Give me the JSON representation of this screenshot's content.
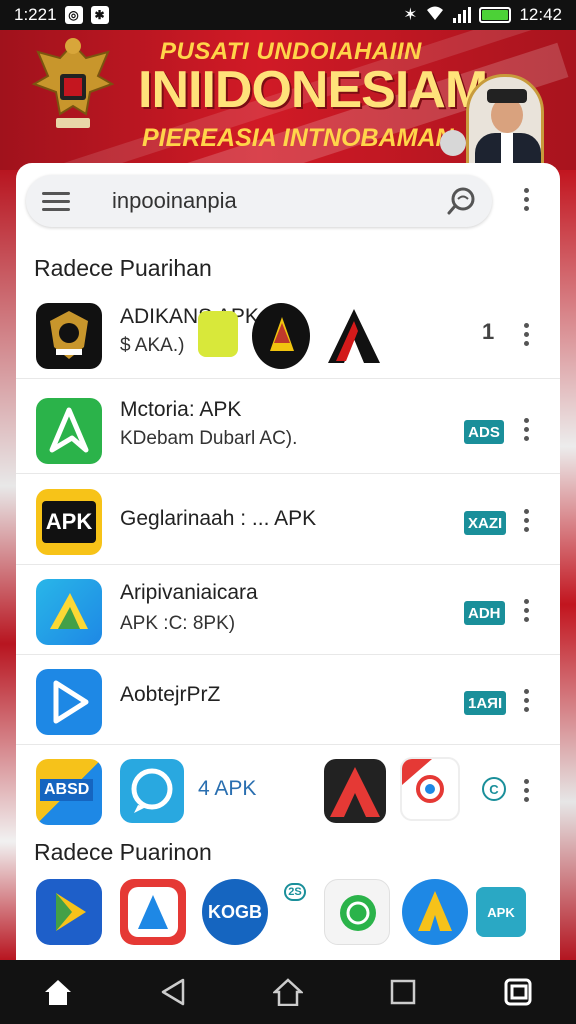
{
  "status_bar": {
    "time_left": "1:221",
    "time_right": "12:42",
    "battery_percent": 100
  },
  "banner": {
    "line1": "PUSATI UNDOIAHAIIN",
    "line2": "INIIDONESIAM",
    "line3": "PIEREASIA INTNOBAMAN"
  },
  "search": {
    "value": "inpooinanpia"
  },
  "section1_title": "Radece Puarihan",
  "section2_title": "Radece Puarinon",
  "apps": [
    {
      "title": "ADIKANS APK",
      "subtitle": "$ AKA.)",
      "count": "1",
      "badge": ""
    },
    {
      "title": "Mctoria: APK",
      "subtitle": "KDebam Dubarl AC).",
      "count": "",
      "badge": "ADS"
    },
    {
      "title": "Geglarinaah : ... APK",
      "subtitle": "",
      "count": "",
      "badge": "XAZI"
    },
    {
      "title": "Aripivaniaicara",
      "subtitle": "APK :C: 8PK)",
      "count": "",
      "badge": "ADH"
    },
    {
      "title": "AobtejrPrZ",
      "subtitle": "",
      "count": "",
      "badge": "1AЯI"
    },
    {
      "title": "4 APK",
      "subtitle": "",
      "count": "",
      "badge": ""
    }
  ],
  "icon_texts": {
    "apk": "APK",
    "absd": "ABSD",
    "koga": "KOGB",
    "apk2": "APK",
    "badge_2s": "2S",
    "c_badge": "C"
  },
  "colors": {
    "banner_red": "#d11a26",
    "banner_gold": "#ffd54a",
    "badge_teal": "#1a8f9a"
  }
}
